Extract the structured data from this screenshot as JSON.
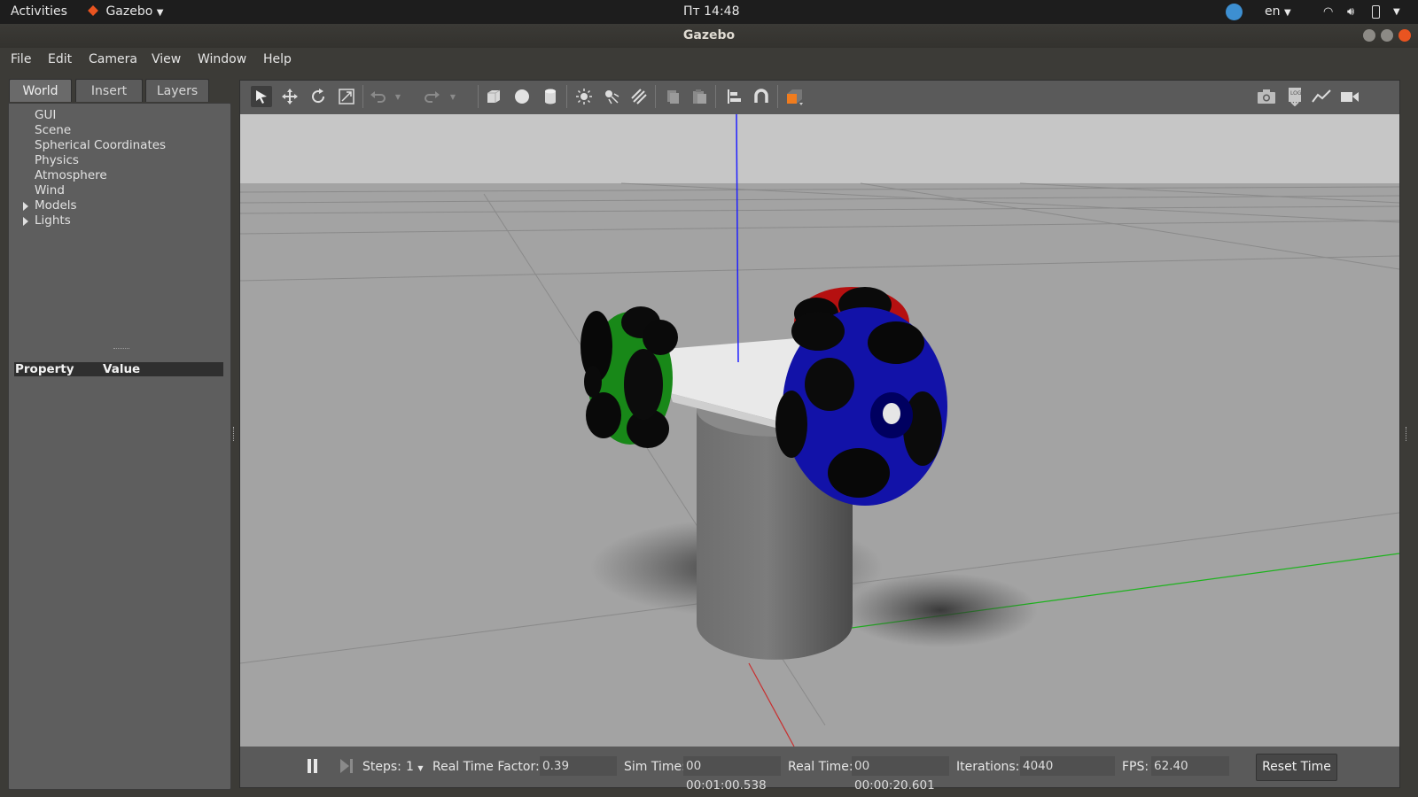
{
  "topbar": {
    "activities": "Activities",
    "app_name": "Gazebo",
    "clock": "Пт 14:48",
    "language": "en"
  },
  "window": {
    "title": "Gazebo"
  },
  "menu": [
    "File",
    "Edit",
    "Camera",
    "View",
    "Window",
    "Help"
  ],
  "left_panel": {
    "tabs": [
      "World",
      "Insert",
      "Layers"
    ],
    "active_tab": "World",
    "tree": [
      "GUI",
      "Scene",
      "Spherical Coordinates",
      "Physics",
      "Atmosphere",
      "Wind",
      "Models",
      "Lights"
    ],
    "property_header": {
      "property": "Property",
      "value": "Value"
    }
  },
  "toolbar_icons": [
    "select-icon",
    "translate-icon",
    "rotate-icon",
    "scale-icon",
    "undo-icon",
    "redo-icon",
    "box-icon",
    "sphere-icon",
    "cylinder-icon",
    "point-light-icon",
    "spot-light-icon",
    "directional-light-icon",
    "copy-icon",
    "paste-icon",
    "align-icon",
    "snap-icon",
    "view-angle-icon",
    "screenshot-icon",
    "log-icon",
    "plot-icon",
    "video-record-icon"
  ],
  "bottom": {
    "steps_label": "Steps:",
    "steps_value": "1",
    "rtf_label": "Real Time Factor:",
    "rtf_value": "0.39",
    "sim_time_label": "Sim Time:",
    "sim_time_value": "00 00:01:00.538",
    "real_time_label": "Real Time:",
    "real_time_value": "00 00:00:20.601",
    "iterations_label": "Iterations:",
    "iterations_value": "4040",
    "fps_label": "FPS:",
    "fps_value": "62.40",
    "reset_label": "Reset Time"
  },
  "colors": {
    "accent": "#e95420",
    "sky": "#c4c4c4",
    "ground": "#a4a4a4",
    "wheel_green": "#1a8c1a",
    "wheel_blue": "#1414b4",
    "wheel_red": "#c81414"
  }
}
